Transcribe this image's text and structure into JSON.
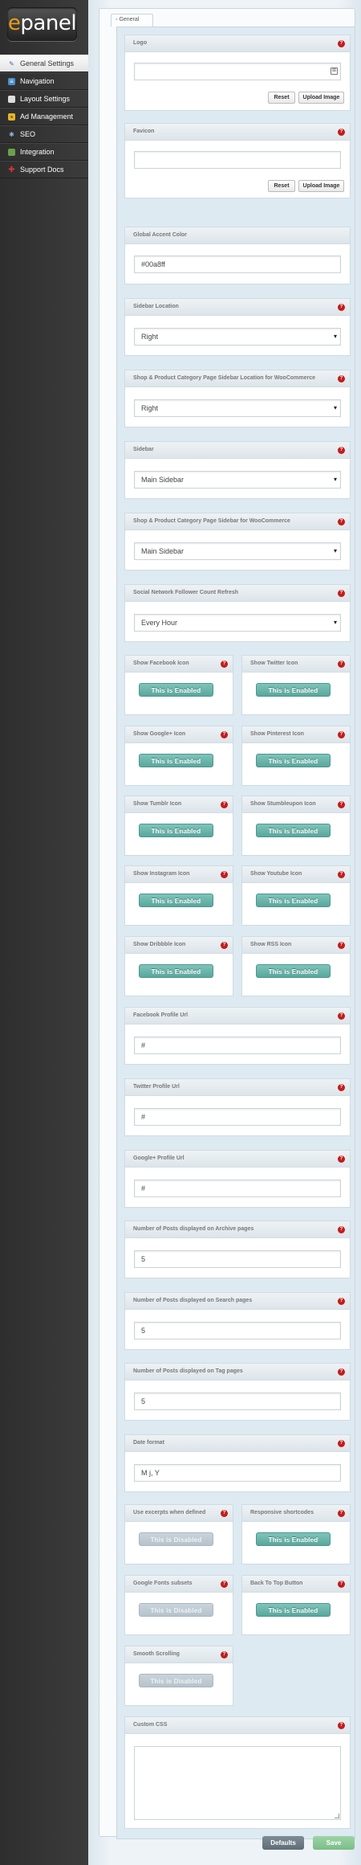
{
  "logo": {
    "e": "e",
    "rest": "panel"
  },
  "nav": [
    {
      "label": "General Settings",
      "icon": "wrench-icon"
    },
    {
      "label": "Navigation",
      "icon": "navigation-icon"
    },
    {
      "label": "Layout Settings",
      "icon": "layout-icon"
    },
    {
      "label": "Ad Management",
      "icon": "ad-icon"
    },
    {
      "label": "SEO",
      "icon": "seo-icon"
    },
    {
      "label": "Integration",
      "icon": "integration-icon"
    },
    {
      "label": "Support Docs",
      "icon": "support-icon"
    }
  ],
  "tab": "General",
  "help": "?",
  "fields": {
    "logo": {
      "label": "Logo",
      "value": "",
      "reset": "Reset",
      "upload": "Upload Image"
    },
    "favicon": {
      "label": "Favicon",
      "value": "",
      "reset": "Reset",
      "upload": "Upload Image"
    },
    "accent": {
      "label": "Global Accent Color",
      "value": "#00a8ff"
    },
    "sidebar_location": {
      "label": "Sidebar Location",
      "value": "Right"
    },
    "shop_sidebar_location": {
      "label": "Shop & Product Category Page Sidebar Location for WooCommerce",
      "value": "Right"
    },
    "sidebar": {
      "label": "Sidebar",
      "value": "Main Sidebar"
    },
    "shop_sidebar": {
      "label": "Shop & Product Category Page Sidebar for WooCommerce",
      "value": "Main Sidebar"
    },
    "follower_refresh": {
      "label": "Social Network Follower Count Refresh",
      "value": "Every Hour"
    },
    "facebook_url": {
      "label": "Facebook Profile Url",
      "value": "#"
    },
    "twitter_url": {
      "label": "Twitter Profile Url",
      "value": "#"
    },
    "gplus_url": {
      "label": "Google+ Profile Url",
      "value": "#"
    },
    "posts_archive": {
      "label": "Number of Posts displayed on Archive pages",
      "value": "5"
    },
    "posts_search": {
      "label": "Number of Posts displayed on Search pages",
      "value": "5"
    },
    "posts_tag": {
      "label": "Number of Posts displayed on Tag pages",
      "value": "5"
    },
    "date_format": {
      "label": "Date format",
      "value": "M j, Y"
    },
    "custom_css": {
      "label": "Custom CSS",
      "value": ""
    }
  },
  "toggles": {
    "facebook": {
      "label": "Show Facebook Icon",
      "state": "This is Enabled"
    },
    "twitter": {
      "label": "Show Twitter Icon",
      "state": "This is Enabled"
    },
    "gplus": {
      "label": "Show Google+ Icon",
      "state": "This is Enabled"
    },
    "pinterest": {
      "label": "Show Pinterest Icon",
      "state": "This is Enabled"
    },
    "tumblr": {
      "label": "Show Tumblr Icon",
      "state": "This is Enabled"
    },
    "stumbleupon": {
      "label": "Show Stumbleupon Icon",
      "state": "This is Enabled"
    },
    "instagram": {
      "label": "Show Instagram Icon",
      "state": "This is Enabled"
    },
    "youtube": {
      "label": "Show Youtube Icon",
      "state": "This is Enabled"
    },
    "dribbble": {
      "label": "Show Dribbble Icon",
      "state": "This is Enabled"
    },
    "rss": {
      "label": "Show RSS Icon",
      "state": "This is Enabled"
    },
    "excerpts": {
      "label": "Use excerpts when defined",
      "state": "This is Disabled"
    },
    "shortcodes": {
      "label": "Responsive shortcodes",
      "state": "This is Enabled"
    },
    "gfonts": {
      "label": "Google Fonts subsets",
      "state": "This is Disabled"
    },
    "backtotop": {
      "label": "Back To Top Button",
      "state": "This is Enabled"
    },
    "smooth": {
      "label": "Smooth Scrolling",
      "state": "This is Disabled"
    }
  },
  "footer": {
    "defaults": "Defaults",
    "save": "Save"
  },
  "colors": {
    "accent_orange": "#e79b1b",
    "enabled": "#5aa79d",
    "disabled": "#b6c3cb",
    "help": "#c41c1c"
  }
}
